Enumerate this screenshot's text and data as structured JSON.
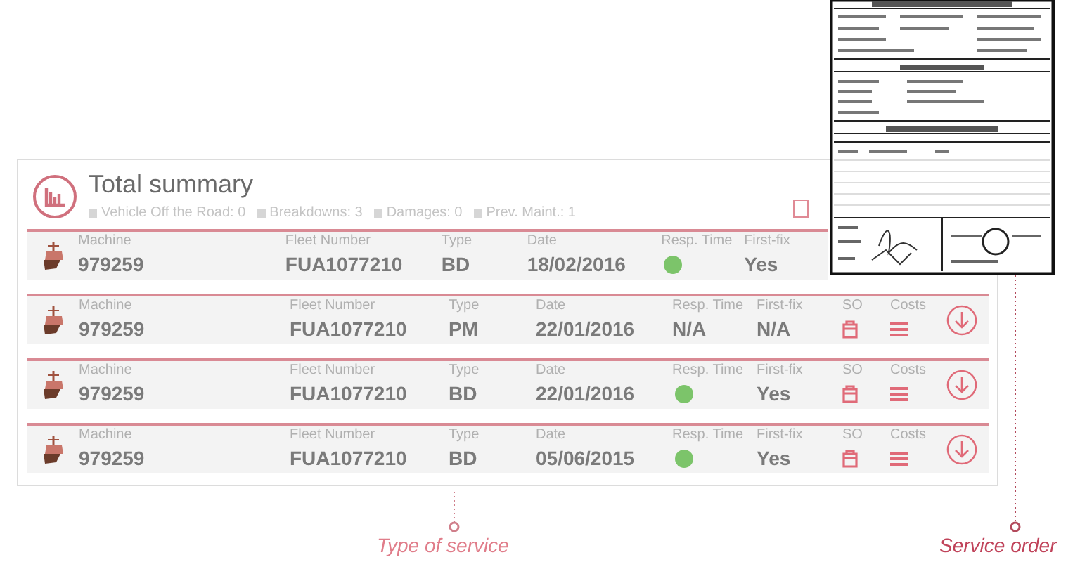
{
  "summary": {
    "title": "Total summary",
    "legend": [
      {
        "label": "Vehicle Off the Road: 0"
      },
      {
        "label": "Breakdowns: 3"
      },
      {
        "label": "Damages: 0"
      },
      {
        "label": "Prev. Maint.: 1"
      }
    ]
  },
  "rows": [
    {
      "cells": [
        {
          "kind": "text",
          "label": "Machine",
          "value": "979259"
        },
        {
          "kind": "text",
          "label": "Fleet Number",
          "value": "FUA1077210"
        },
        {
          "kind": "text",
          "label": "Type",
          "value": "BD"
        },
        {
          "kind": "text",
          "label": "Date",
          "value": "18/02/2016"
        },
        {
          "kind": "dot",
          "label": "Resp. Time",
          "color": "#7cc46a"
        },
        {
          "kind": "text",
          "label": "First-fix",
          "value": "Yes"
        }
      ]
    },
    {
      "cells": [
        {
          "kind": "text",
          "label": "Machine",
          "value": "979259"
        },
        {
          "kind": "text",
          "label": "Fleet Number",
          "value": "FUA1077210"
        },
        {
          "kind": "text",
          "label": "Type",
          "value": "PM"
        },
        {
          "kind": "text",
          "label": "Date",
          "value": "22/01/2016"
        },
        {
          "kind": "text",
          "label": "Resp. Time",
          "value": "N/A"
        },
        {
          "kind": "text",
          "label": "First-fix",
          "value": "N/A"
        },
        {
          "kind": "so",
          "label": "SO"
        },
        {
          "kind": "costs",
          "label": "Costs"
        },
        {
          "kind": "download"
        }
      ]
    },
    {
      "cells": [
        {
          "kind": "text",
          "label": "Machine",
          "value": "979259"
        },
        {
          "kind": "text",
          "label": "Fleet Number",
          "value": "FUA1077210"
        },
        {
          "kind": "text",
          "label": "Type",
          "value": "BD"
        },
        {
          "kind": "text",
          "label": "Date",
          "value": "22/01/2016"
        },
        {
          "kind": "dot",
          "label": "Resp. Time",
          "color": "#7cc46a"
        },
        {
          "kind": "text",
          "label": "First-fix",
          "value": "Yes"
        },
        {
          "kind": "so",
          "label": "SO"
        },
        {
          "kind": "costs",
          "label": "Costs"
        },
        {
          "kind": "download"
        }
      ]
    },
    {
      "cells": [
        {
          "kind": "text",
          "label": "Machine",
          "value": "979259"
        },
        {
          "kind": "text",
          "label": "Fleet Number",
          "value": "FUA1077210"
        },
        {
          "kind": "text",
          "label": "Type",
          "value": "BD"
        },
        {
          "kind": "text",
          "label": "Date",
          "value": "05/06/2015"
        },
        {
          "kind": "dot",
          "label": "Resp. Time",
          "color": "#7cc46a"
        },
        {
          "kind": "text",
          "label": "First-fix",
          "value": "Yes"
        },
        {
          "kind": "so",
          "label": "SO"
        },
        {
          "kind": "costs",
          "label": "Costs"
        },
        {
          "kind": "download"
        }
      ]
    }
  ],
  "annotations": [
    {
      "label": "Type of service"
    },
    {
      "label": "Service order"
    }
  ]
}
